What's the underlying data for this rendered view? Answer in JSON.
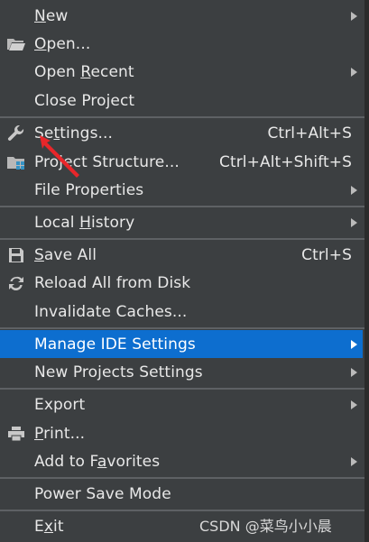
{
  "menu": {
    "new": {
      "prefix": "",
      "mn": "N",
      "suffix": "ew"
    },
    "open": {
      "prefix": "",
      "mn": "O",
      "suffix": "pen..."
    },
    "open_recent": {
      "prefix": "Open ",
      "mn": "R",
      "suffix": "ecent"
    },
    "close_project": {
      "label": "Close Project"
    },
    "settings": {
      "prefix": "Se",
      "mn": "t",
      "suffix": "tings...",
      "shortcut": "Ctrl+Alt+S"
    },
    "project_structure": {
      "label": "Project Structure...",
      "shortcut": "Ctrl+Alt+Shift+S"
    },
    "file_properties": {
      "label": "File Properties"
    },
    "local_history": {
      "prefix": "Local ",
      "mn": "H",
      "suffix": "istory"
    },
    "save_all": {
      "prefix": "",
      "mn": "S",
      "suffix": "ave All",
      "shortcut": "Ctrl+S"
    },
    "reload": {
      "label": "Reload All from Disk"
    },
    "invalidate": {
      "label": "Invalidate Caches..."
    },
    "manage_ide": {
      "label": "Manage IDE Settings"
    },
    "new_projects": {
      "label": "New Projects Settings"
    },
    "export": {
      "label": "Export"
    },
    "print": {
      "prefix": "",
      "mn": "P",
      "suffix": "rint..."
    },
    "favorites": {
      "prefix": "Add to F",
      "mn": "a",
      "suffix": "vorites"
    },
    "power_save": {
      "label": "Power Save Mode"
    },
    "exit": {
      "prefix": "E",
      "mn": "x",
      "suffix": "it"
    }
  },
  "watermark": "CSDN @菜鸟小小晨",
  "icons": {
    "open": "folder-open-icon",
    "settings": "wrench-icon",
    "project_structure": "project-structure-icon",
    "save_all": "save-icon",
    "reload": "sync-icon",
    "print": "printer-icon"
  },
  "colors": {
    "background": "#3c3f41",
    "selected": "#0d6ecf",
    "separator": "#5e6164",
    "pointer": "#e8262a"
  }
}
